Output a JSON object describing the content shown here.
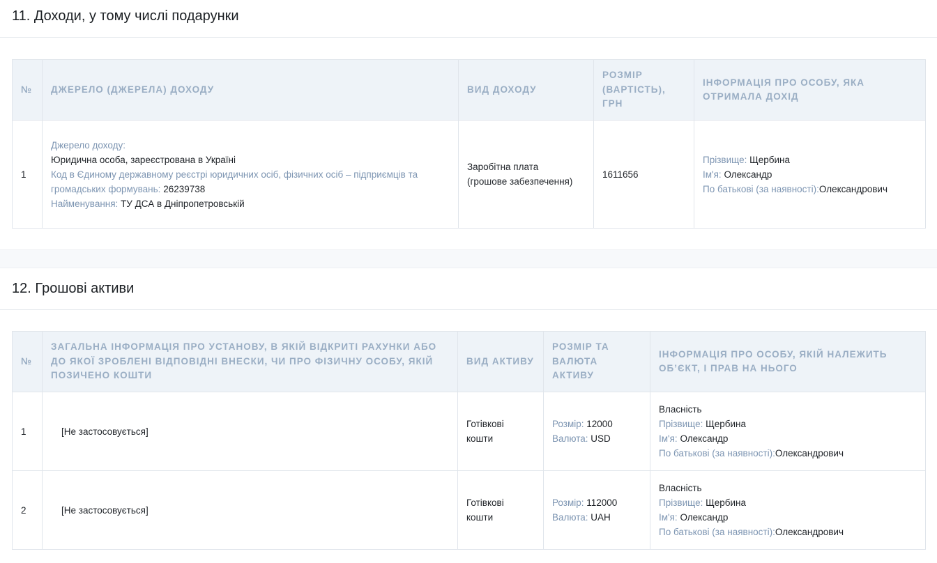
{
  "section11": {
    "title": "11. Доходи, у тому числі подарунки",
    "headers": {
      "num": "№",
      "source": "ДЖЕРЕЛО (ДЖЕРЕЛА) ДОХОДУ",
      "type": "ВИД ДОХОДУ",
      "amount": "РОЗМІР (ВАРТІСТЬ), ГРН",
      "person": "ІНФОРМАЦІЯ ПРО ОСОБУ, ЯКА ОТРИМАЛА ДОХІД"
    },
    "row": {
      "num": "1",
      "source_label": "Джерело доходу:",
      "source_value": "Юридична особа, зареєстрована в Україні",
      "code_label": "Код в Єдиному державному реєстрі юридичних осіб, фізичних осіб – підприємців та громадських формувань:",
      "code_value": "26239738",
      "name_label": "Найменування:",
      "name_value": "ТУ ДСА в Дніпропетровській",
      "type_line1": "Заробітна плата",
      "type_line2": "(грошове забезпечення)",
      "amount": "1611656",
      "surname_label": "Прізвище:",
      "surname": "Щербина",
      "firstname_label": "Ім'я:",
      "firstname": "Олександр",
      "patronymic_label": "По батькові (за наявності):",
      "patronymic": "Олександрович"
    }
  },
  "section12": {
    "title": "12. Грошові активи",
    "headers": {
      "num": "№",
      "institution": "ЗАГАЛЬНА ІНФОРМАЦІЯ ПРО УСТАНОВУ, В ЯКІЙ ВІДКРИТІ РАХУНКИ АБО ДО ЯКОЇ ЗРОБЛЕНІ ВІДПОВІДНІ ВНЕСКИ, ЧИ ПРО ФІЗИЧНУ ОСОБУ, ЯКІЙ ПОЗИЧЕНО КОШТИ",
      "asset_type": "ВИД АКТИВУ",
      "amount": "РОЗМІР ТА ВАЛЮТА АКТИВУ",
      "person": "ІНФОРМАЦІЯ ПРО ОСОБУ, ЯКІЙ НАЛЕЖИТЬ ОБ’ЄКТ, І ПРАВ НА НЬОГО"
    },
    "rows": [
      {
        "num": "1",
        "institution": "[Не застосовується]",
        "asset_line1": "Готівкові",
        "asset_line2": "кошти",
        "size_label": "Розмір:",
        "size": "12000",
        "currency_label": "Валюта:",
        "currency": "USD",
        "ownership": "Власність",
        "surname_label": "Прізвище:",
        "surname": "Щербина",
        "firstname_label": "Ім'я:",
        "firstname": "Олександр",
        "patronymic_label": "По батькові (за наявності):",
        "patronymic": "Олександрович"
      },
      {
        "num": "2",
        "institution": "[Не застосовується]",
        "asset_line1": "Готівкові",
        "asset_line2": "кошти",
        "size_label": "Розмір:",
        "size": "112000",
        "currency_label": "Валюта:",
        "currency": "UAH",
        "ownership": "Власність",
        "surname_label": "Прізвище:",
        "surname": "Щербина",
        "firstname_label": "Ім'я:",
        "firstname": "Олександр",
        "patronymic_label": "По батькові (за наявності):",
        "patronymic": "Олександрович"
      }
    ]
  }
}
